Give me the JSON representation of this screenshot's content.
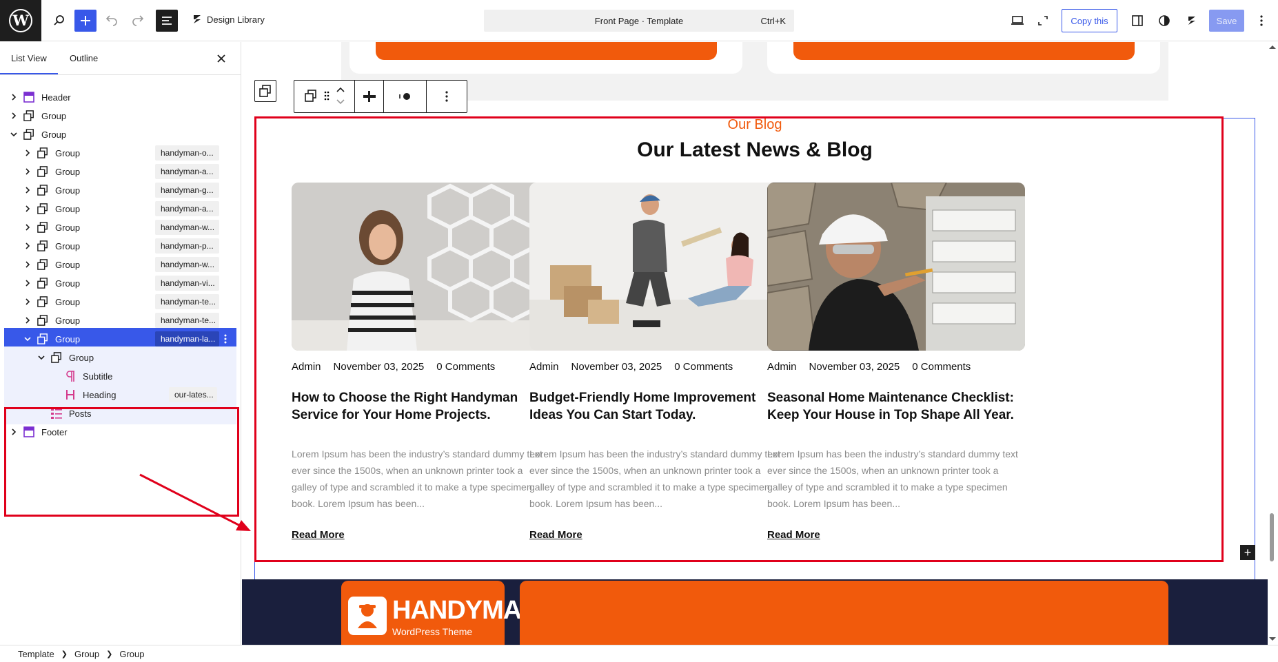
{
  "topbar": {
    "design_library": "Design Library",
    "command_title": "Front Page · Template",
    "command_shortcut": "Ctrl+K",
    "copy_label": "Copy this",
    "save_label": "Save"
  },
  "sidebar": {
    "tab_list_view": "List View",
    "tab_outline": "Outline",
    "rows": [
      {
        "label": "Header",
        "badge": "",
        "icon": "template-part-icon"
      },
      {
        "label": "Group",
        "badge": "",
        "icon": "group-icon"
      },
      {
        "label": "Group",
        "badge": "",
        "icon": "group-icon"
      },
      {
        "label": "Group",
        "badge": "handyman-o...",
        "icon": "group-icon"
      },
      {
        "label": "Group",
        "badge": "handyman-a...",
        "icon": "group-icon"
      },
      {
        "label": "Group",
        "badge": "handyman-g...",
        "icon": "group-icon"
      },
      {
        "label": "Group",
        "badge": "handyman-a...",
        "icon": "group-icon"
      },
      {
        "label": "Group",
        "badge": "handyman-w...",
        "icon": "group-icon"
      },
      {
        "label": "Group",
        "badge": "handyman-p...",
        "icon": "group-icon"
      },
      {
        "label": "Group",
        "badge": "handyman-w...",
        "icon": "group-icon"
      },
      {
        "label": "Group",
        "badge": "handyman-vi...",
        "icon": "group-icon"
      },
      {
        "label": "Group",
        "badge": "handyman-te...",
        "icon": "group-icon"
      },
      {
        "label": "Group",
        "badge": "handyman-te...",
        "icon": "group-icon"
      },
      {
        "label": "Group",
        "badge": "handyman-la...",
        "icon": "group-icon"
      },
      {
        "label": "Group",
        "badge": "",
        "icon": "group-icon"
      },
      {
        "label": "Subtitle",
        "badge": "",
        "icon": "paragraph-icon"
      },
      {
        "label": "Heading",
        "badge": "our-lates...",
        "icon": "heading-icon"
      },
      {
        "label": "Posts",
        "badge": "",
        "icon": "posts-icon"
      },
      {
        "label": "Footer",
        "badge": "",
        "icon": "template-part-icon"
      }
    ]
  },
  "blog": {
    "subtitle": "Our Blog",
    "title": "Our Latest News & Blog",
    "posts": [
      {
        "author": "Admin",
        "date": "November 03, 2025",
        "comments": "0 Comments",
        "title": "How to Choose the Right Handyman Service for Your Home Projects.",
        "excerpt": "Lorem Ipsum has been the industry’s standard dummy text ever since the 1500s, when an unknown printer took a galley of type and scrambled it to make a type specimen book. Lorem Ipsum has been...",
        "read_more": "Read More"
      },
      {
        "author": "Admin",
        "date": "November 03, 2025",
        "comments": "0 Comments",
        "title": "Budget-Friendly Home Improvement Ideas You Can Start Today.",
        "excerpt": "Lorem Ipsum has been the industry’s standard dummy text ever since the 1500s, when an unknown printer took a galley of type and scrambled it to make a type specimen book. Lorem Ipsum has been...",
        "read_more": "Read More"
      },
      {
        "author": "Admin",
        "date": "November 03, 2025",
        "comments": "0 Comments",
        "title": "Seasonal Home Maintenance Checklist: Keep Your House in Top Shape All Year.",
        "excerpt": "Lorem Ipsum has been the industry’s standard dummy text ever since the 1500s, when an unknown printer took a galley of type and scrambled it to make a type specimen book. Lorem Ipsum has been...",
        "read_more": "Read More"
      }
    ]
  },
  "footer": {
    "logo_name": "HANDYMAN",
    "logo_sub": "WordPress Theme"
  },
  "breadcrumb": [
    "Template",
    "Group",
    "Group"
  ],
  "colors": {
    "accent": "#3858e9",
    "brand_orange": "#f15a0c",
    "annotation_red": "#e0001b",
    "footer_navy": "#1a1f3d"
  }
}
